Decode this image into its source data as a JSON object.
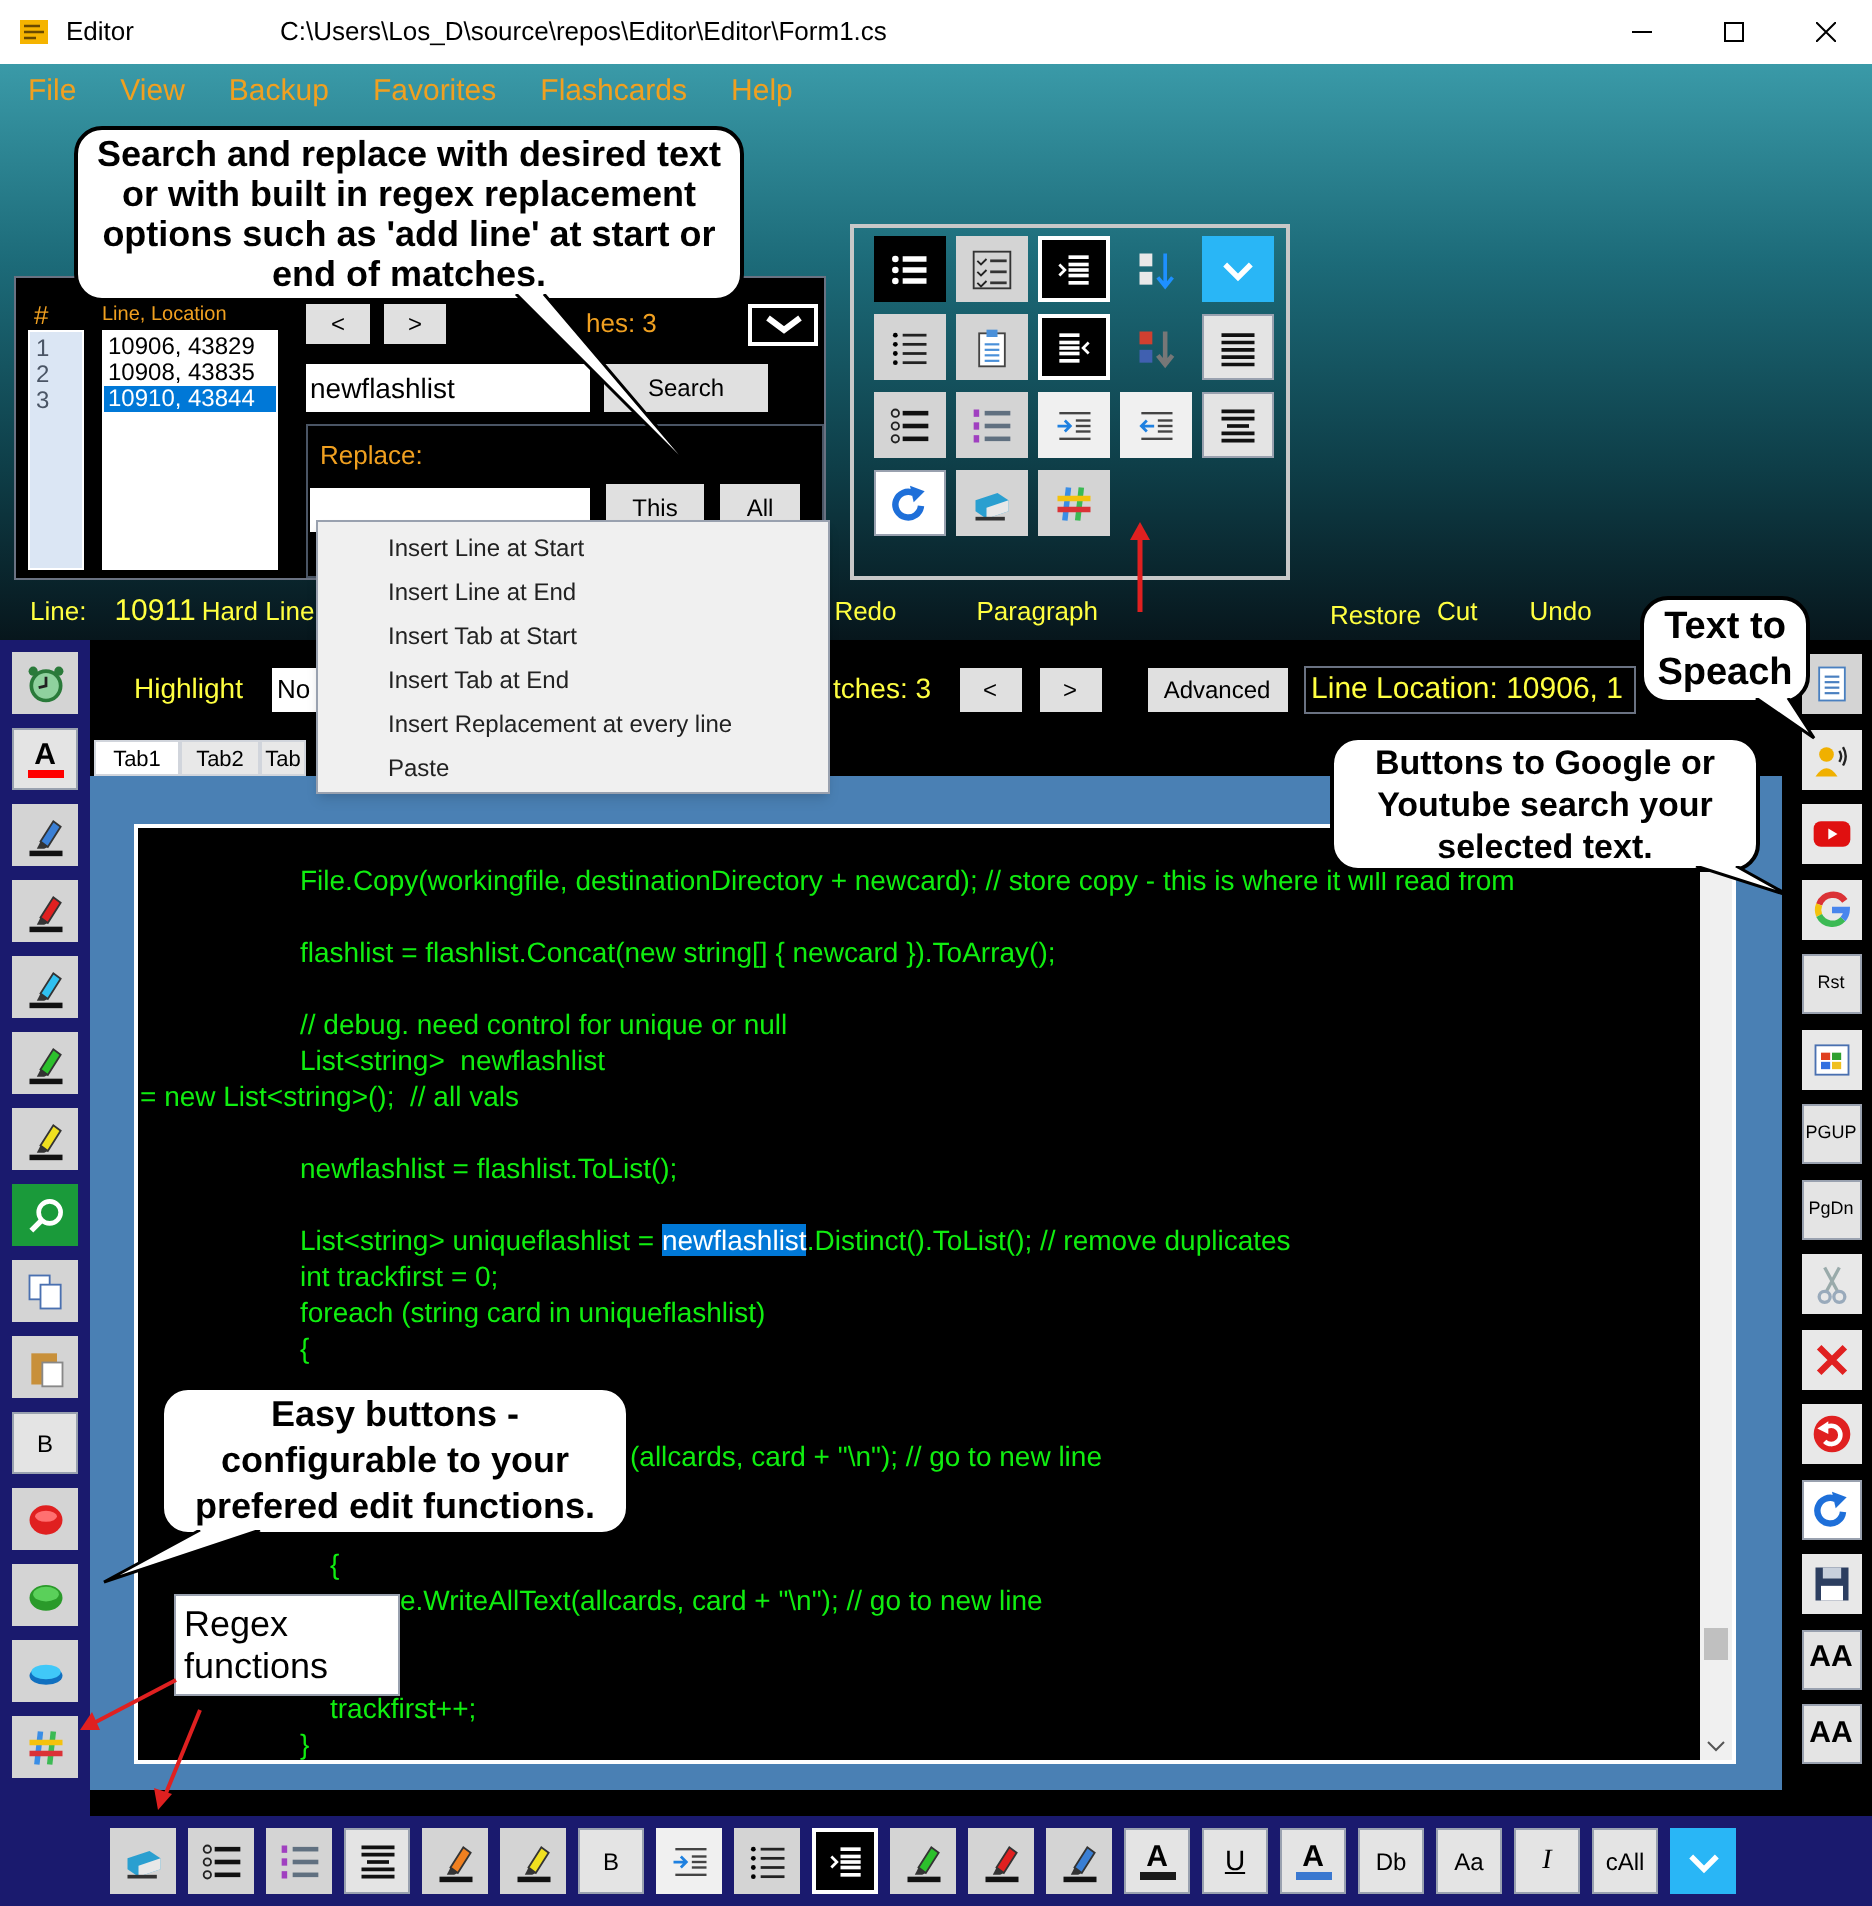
{
  "window": {
    "title": "Editor",
    "path": "C:\\Users\\Los_D\\source\\repos\\Editor\\Editor\\Form1.cs"
  },
  "menu": [
    "File",
    "View",
    "Backup",
    "Favorites",
    "Flashcards",
    "Help"
  ],
  "search_panel": {
    "number_header": "#",
    "list_header": "Line, Location",
    "numbers": [
      "1",
      "2",
      "3"
    ],
    "results": [
      {
        "line": "10906,",
        "location": "43829",
        "selected": false
      },
      {
        "line": "10908,",
        "location": "43835",
        "selected": false
      },
      {
        "line": "10910,",
        "location": "43844",
        "selected": true
      }
    ],
    "prev": "<",
    "next": ">",
    "matches": "hes: 3",
    "query": "newflashlist",
    "search_button": "Search",
    "replace_label": "Replace:",
    "replace_this": "This",
    "replace_all": "All"
  },
  "replace_menu": [
    "Insert Line at Start",
    "Insert Line at End",
    "Insert Tab at Start",
    "Insert Tab at End",
    "Insert Replacement at every line",
    "Paste"
  ],
  "status_labels": {
    "line_label": "Line:",
    "line_number": "10911",
    "hard_line": "Hard Line",
    "redo": "Redo",
    "paragraph": "Paragraph",
    "restore": "Restore",
    "cut": "Cut",
    "undo": "Undo"
  },
  "highlight_bar": {
    "label": "Highlight",
    "dropdown_value": "No",
    "matches": "tches: 3",
    "prev": "<",
    "next": ">",
    "advanced": "Advanced",
    "line_location": "Line Location: 10906, 1"
  },
  "tabs": [
    {
      "label": "Tab1",
      "selected": true
    },
    {
      "label": "Tab2",
      "selected": false
    },
    {
      "label": "Tab",
      "selected": false
    }
  ],
  "code_lines": [
    {
      "kind": "code",
      "parts": [
        {
          "text": "File.Copy(workingfile, destinationDirectory + newcard); // store copy - this is where it will read from",
          "selected": false
        }
      ]
    },
    {
      "kind": "spaced",
      "parts": [
        {
          "text": "flashlist = flashlist.Concat(new string[] { newcard }).ToArray();",
          "selected": false
        }
      ]
    },
    {
      "kind": "spaced",
      "parts": [
        {
          "text": "// debug. need control for unique or null",
          "selected": false
        }
      ]
    },
    {
      "kind": "code",
      "parts": [
        {
          "text": "List<string>  newflashlist",
          "selected": false
        }
      ]
    },
    {
      "kind": "wrapped",
      "parts": [
        {
          "text": "= new List<string>();  // all vals",
          "selected": false
        }
      ]
    },
    {
      "kind": "spaced",
      "parts": [
        {
          "text": "newflashlist = flashlist.ToList();",
          "selected": false
        }
      ]
    },
    {
      "kind": "spaced",
      "parts": [
        {
          "text": "List<string> uniqueflashlist = ",
          "selected": false
        },
        {
          "text": "newflashlist",
          "selected": true
        },
        {
          "text": ".Distinct().ToList(); // remove duplicates",
          "selected": false
        }
      ]
    },
    {
      "kind": "code",
      "parts": [
        {
          "text": "int trackfirst = 0;",
          "selected": false
        }
      ]
    },
    {
      "kind": "code",
      "parts": [
        {
          "text": "foreach (string card in uniqueflashlist)",
          "selected": false
        }
      ]
    },
    {
      "kind": "code",
      "parts": [
        {
          "text": "{",
          "selected": false
        }
      ]
    },
    {
      "kind": "resumed-far",
      "parts": [
        {
          "text": "(allcards, card + \"\\n\"); // go to new line",
          "selected": false
        }
      ]
    },
    {
      "kind": "resumed-brace",
      "parts": [
        {
          "text": "{",
          "selected": false
        }
      ]
    },
    {
      "kind": "resumed-mid",
      "parts": [
        {
          "text": "e.WriteAllText(allcards, card + \"\\n\"); // go to new line",
          "selected": false
        }
      ]
    },
    {
      "kind": "late",
      "parts": [
        {
          "text": "trackfirst++;",
          "selected": false
        }
      ]
    },
    {
      "kind": "code",
      "parts": [
        {
          "text": "}",
          "selected": false
        }
      ]
    }
  ],
  "left_toolbar": [
    {
      "kind": "icon"
    },
    {
      "kind": "font-color",
      "label": "A",
      "color": "#ff0000"
    },
    {
      "kind": "icon"
    },
    {
      "kind": "icon"
    },
    {
      "kind": "icon"
    },
    {
      "kind": "icon"
    },
    {
      "kind": "icon"
    },
    {
      "kind": "icon"
    },
    {
      "kind": "icon"
    },
    {
      "kind": "icon"
    },
    {
      "kind": "text",
      "label": "B"
    },
    {
      "kind": "icon"
    },
    {
      "kind": "icon"
    },
    {
      "kind": "icon"
    },
    {
      "kind": "icon"
    }
  ],
  "right_toolbar": [
    {
      "kind": "icon"
    },
    {
      "kind": "icon"
    },
    {
      "kind": "icon"
    },
    {
      "kind": "icon"
    },
    {
      "kind": "text",
      "label": "Rst"
    },
    {
      "kind": "icon"
    },
    {
      "kind": "text",
      "label": "PGUP"
    },
    {
      "kind": "text",
      "label": "PgDn"
    },
    {
      "kind": "icon"
    },
    {
      "kind": "icon"
    },
    {
      "kind": "icon"
    },
    {
      "kind": "icon"
    },
    {
      "kind": "icon"
    },
    {
      "kind": "bold-text",
      "label": "AA"
    },
    {
      "kind": "bold-text",
      "label": "AA"
    }
  ],
  "bottom_toolbar": [
    {
      "kind": "icon"
    },
    {
      "kind": "icon"
    },
    {
      "kind": "icon"
    },
    {
      "kind": "icon"
    },
    {
      "kind": "icon"
    },
    {
      "kind": "icon"
    },
    {
      "kind": "text",
      "label": "B"
    },
    {
      "kind": "icon"
    },
    {
      "kind": "icon"
    },
    {
      "kind": "icon"
    },
    {
      "kind": "icon"
    },
    {
      "kind": "icon"
    },
    {
      "kind": "icon"
    },
    {
      "kind": "font-color",
      "label": "A",
      "color": "#1a1a1a"
    },
    {
      "kind": "underline-text",
      "label": "U"
    },
    {
      "kind": "font-color",
      "label": "A",
      "color": "#3a78d0"
    },
    {
      "kind": "text",
      "label": "Db"
    },
    {
      "kind": "text",
      "label": "Aa"
    },
    {
      "kind": "italic-text",
      "label": "I"
    },
    {
      "kind": "text",
      "label": "cAll"
    },
    {
      "kind": "icon"
    }
  ],
  "callouts": [
    {
      "kind": "bubble",
      "text": "Search and replace with desired text or with built in regex replacement options such as 'add line' at start or end of matches."
    },
    {
      "kind": "bubble",
      "text": "Text to Speach"
    },
    {
      "kind": "bubble",
      "text": "Buttons to Google or Youtube search your selected text."
    },
    {
      "kind": "bubble",
      "text": "Easy buttons - configurable to your prefered edit functions."
    },
    {
      "kind": "box",
      "text": "Regex functions"
    }
  ]
}
